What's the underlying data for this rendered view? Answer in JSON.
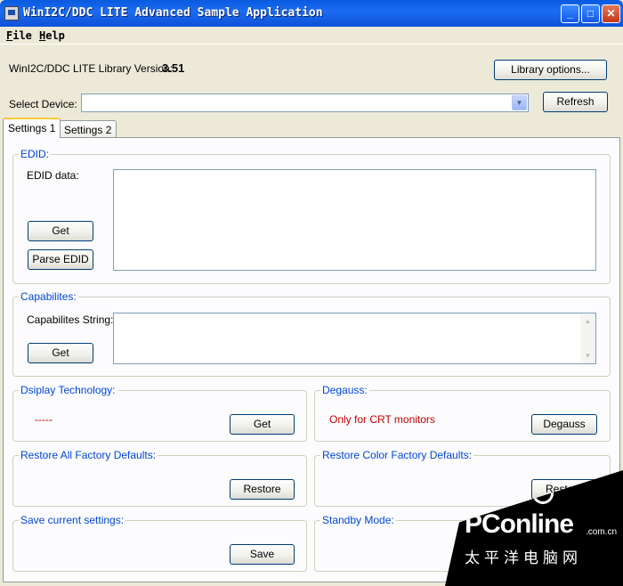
{
  "window": {
    "title": "WinI2C/DDC LITE Advanced Sample Application"
  },
  "menu": {
    "file": "File",
    "help": "Help"
  },
  "library": {
    "label": "WinI2C/DDC LITE Library Version:",
    "version": "3.51",
    "options_button": "Library options..."
  },
  "device": {
    "label": "Select Device:",
    "value": "",
    "refresh_button": "Refresh"
  },
  "tabs": [
    {
      "label": "Settings 1",
      "active": true
    },
    {
      "label": "Settings 2",
      "active": false
    }
  ],
  "edid": {
    "group_title": "EDID:",
    "data_label": "EDID data:",
    "get_button": "Get",
    "parse_button": "Parse EDID",
    "data_value": ""
  },
  "capabilities": {
    "group_title": "Capabilites:",
    "string_label": "Capabilites String:",
    "get_button": "Get",
    "string_value": ""
  },
  "display_technology": {
    "group_title": "Dsiplay Technology:",
    "value": "-----",
    "get_button": "Get"
  },
  "degauss": {
    "group_title": "Degauss:",
    "note": "Only for CRT monitors",
    "button": "Degauss"
  },
  "restore_all": {
    "group_title": "Restore All Factory Defaults:",
    "button": "Restore"
  },
  "restore_color": {
    "group_title": "Restore Color Factory Defaults:",
    "button": "Restore"
  },
  "save_settings": {
    "group_title": "Save current settings:",
    "button": "Save"
  },
  "standby": {
    "group_title": "Standby Mode:"
  },
  "watermark": {
    "brand": "PConline",
    "domain": ".com.cn",
    "chinese": "太平洋电脑网"
  },
  "colors": {
    "title_bar": "#0a5ae0",
    "group_title": "#0046d5",
    "note_red": "#c00000",
    "dialog_bg": "#ece9d8"
  },
  "icons": [
    "app-icon",
    "minimize-icon",
    "maximize-icon",
    "close-icon",
    "chevron-down-icon",
    "scroll-up-icon",
    "scroll-down-icon"
  ]
}
